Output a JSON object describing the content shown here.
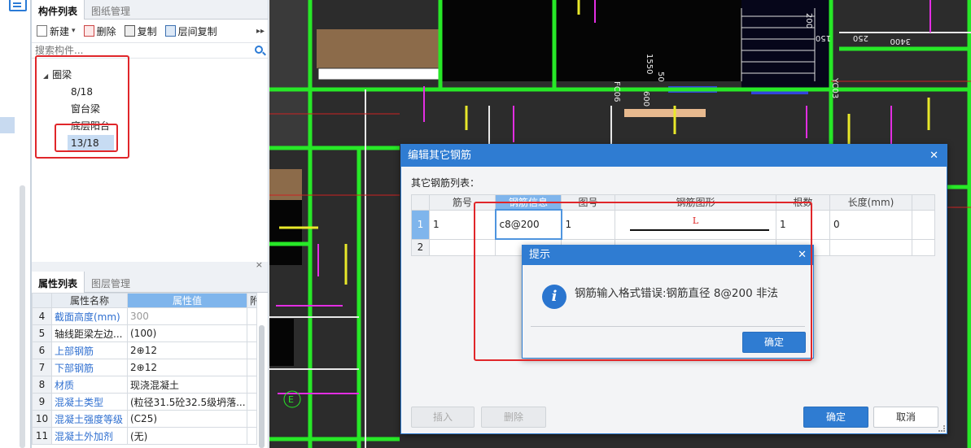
{
  "component_panel": {
    "tabs": [
      "构件列表",
      "图纸管理"
    ],
    "toolbar": {
      "new_label": "新建",
      "delete_label": "删除",
      "copy_label": "复制",
      "layer_copy_label": "层间复制"
    },
    "search_placeholder": "搜索构件...",
    "tree": {
      "root_label": "圈梁",
      "items": [
        "8/18",
        "窗台梁",
        "底层阳台",
        "13/18"
      ],
      "selected_item": "13/18"
    }
  },
  "property_panel": {
    "tabs": [
      "属性列表",
      "图层管理"
    ],
    "headers": {
      "name": "属性名称",
      "value": "属性值",
      "extra": "附"
    },
    "rows": [
      {
        "num": "4",
        "name": "截面高度(mm)",
        "value": "300"
      },
      {
        "num": "5",
        "name": "轴线距梁左边...",
        "value": "(100)"
      },
      {
        "num": "6",
        "name": "上部钢筋",
        "value": "2⊕12"
      },
      {
        "num": "7",
        "name": "下部钢筋",
        "value": "2⊕12"
      },
      {
        "num": "8",
        "name": "材质",
        "value": "现浇混凝土"
      },
      {
        "num": "9",
        "name": "混凝土类型",
        "value": "(粒径31.5砼32.5级坍落..."
      },
      {
        "num": "10",
        "name": "混凝土强度等级",
        "value": "(C25)"
      },
      {
        "num": "11",
        "name": "混凝土外加剂",
        "value": "(无)"
      }
    ]
  },
  "cad_labels": [
    "1550",
    "50",
    "600",
    "FC06",
    "200",
    "150",
    "250",
    "3400",
    "YC03",
    "E"
  ],
  "dialog": {
    "title": "编辑其它钢筋",
    "list_label": "其它钢筋列表：",
    "headers": [
      "筋号",
      "钢筋信息",
      "图号",
      "钢筋图形",
      "根数",
      "长度(mm)"
    ],
    "rows": [
      {
        "row_num": "1",
        "bar_no": "1",
        "info": "c8@200",
        "fig_no": "1",
        "shape_label": "L",
        "count": "1",
        "length": "0"
      },
      {
        "row_num": "2",
        "bar_no": "",
        "info": "",
        "fig_no": "",
        "shape_label": "",
        "count": "",
        "length": ""
      }
    ],
    "buttons": {
      "insert": "插入",
      "delete": "删除",
      "ok": "确定",
      "cancel": "取消"
    }
  },
  "tip_dialog": {
    "title": "提示",
    "message": "钢筋输入格式错误:钢筋直径 8@200 非法",
    "ok": "确定"
  },
  "colors": {
    "accent": "#2f7cd2",
    "highlight_box": "#e0262a",
    "cad_background": "#2c2c2c"
  }
}
